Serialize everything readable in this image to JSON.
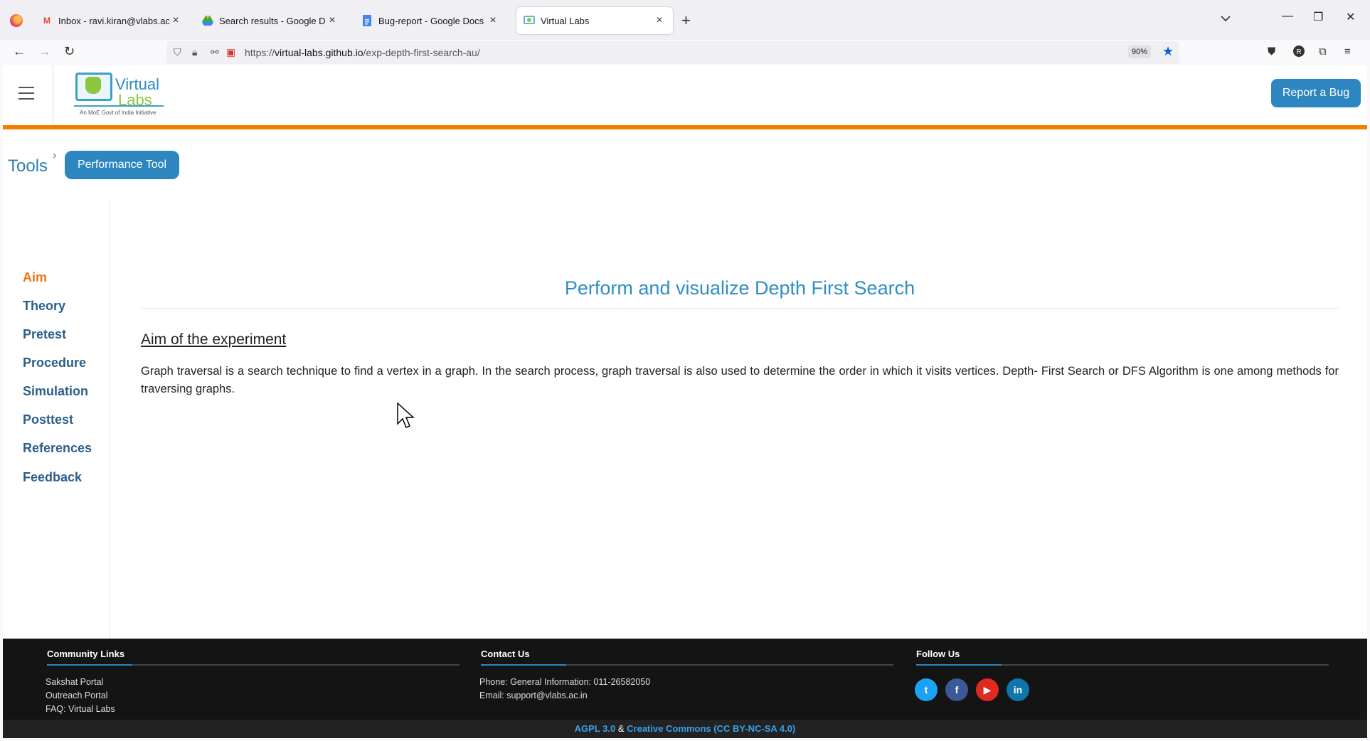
{
  "browser": {
    "tabs": [
      {
        "title": "Inbox - ravi.kiran@vlabs.ac.in -",
        "icon": "gmail-icon"
      },
      {
        "title": "Search results - Google Drive",
        "icon": "google-drive-icon"
      },
      {
        "title": "Bug-report - Google Docs",
        "icon": "google-docs-icon"
      },
      {
        "title": "Virtual Labs",
        "icon": "virtual-labs-icon"
      }
    ],
    "url_prefix": "https://",
    "url_host": "virtual-labs.github.io",
    "url_path": "/exp-depth-first-search-au/",
    "zoom": "90%"
  },
  "header": {
    "logo_line1": "Virtual",
    "logo_line2": "Labs",
    "logo_tagline": "An MoE Govt of India Initiative",
    "report_label": "Report a Bug"
  },
  "breadcrumb": {
    "root": "Tools",
    "button": "Performance Tool"
  },
  "sidebar": {
    "items": [
      {
        "label": "Aim",
        "active": true
      },
      {
        "label": "Theory"
      },
      {
        "label": "Pretest"
      },
      {
        "label": "Procedure"
      },
      {
        "label": "Simulation"
      },
      {
        "label": "Posttest"
      },
      {
        "label": "References"
      },
      {
        "label": "Feedback"
      }
    ]
  },
  "main": {
    "title": "Perform and visualize Depth First Search",
    "heading": "Aim of the experiment",
    "paragraph": "Graph traversal is a search technique to find a vertex in a graph. In the search process, graph traversal is also used to determine the order in which it visits vertices. Depth- First Search or DFS Algorithm is one among methods for traversing graphs."
  },
  "footer": {
    "community": {
      "heading": "Community Links",
      "links": [
        "Sakshat Portal",
        "Outreach Portal",
        "FAQ: Virtual Labs"
      ]
    },
    "contact": {
      "heading": "Contact Us",
      "phone": "Phone: General Information: 011-26582050",
      "email": "Email: support@vlabs.ac.in"
    },
    "follow": {
      "heading": "Follow Us",
      "networks": [
        "twitter",
        "facebook",
        "youtube",
        "linkedin"
      ]
    },
    "license_1": "AGPL 3.0",
    "license_sep": "&",
    "license_2": "Creative Commons (CC BY-NC-SA 4.0)"
  },
  "colors": {
    "accent": "#2e86c1",
    "active_nav": "#e8731a",
    "header_bar": "#f57c00"
  }
}
